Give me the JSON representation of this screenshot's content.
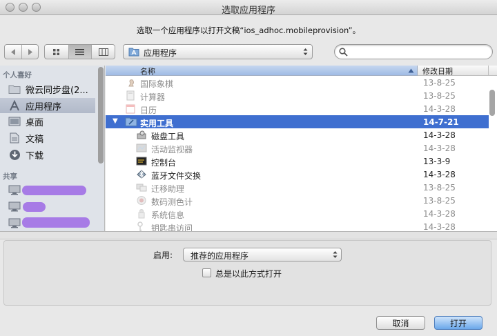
{
  "window": {
    "title": "选取应用程序",
    "prompt": "选取一个应用程序以打开文稿“ios_adhoc.mobileprovision”。"
  },
  "toolbar": {
    "back_icon": "back-arrow-icon",
    "forward_icon": "forward-arrow-icon",
    "view_icons": [
      "icon-view-icon",
      "list-view-icon",
      "column-view-icon"
    ],
    "active_view": "list",
    "location": "应用程序"
  },
  "sidebar": {
    "favorites_header": "个人喜好",
    "favorites": [
      {
        "label": "微云同步盘(2...",
        "icon": "folder-icon"
      },
      {
        "label": "应用程序",
        "icon": "applications-icon",
        "selected": true
      },
      {
        "label": "桌面",
        "icon": "desktop-icon"
      },
      {
        "label": "文稿",
        "icon": "documents-icon"
      },
      {
        "label": "下载",
        "icon": "downloads-icon"
      }
    ],
    "shared_header": "共享",
    "shared_icon": "computer-icon"
  },
  "list": {
    "columns": {
      "name": "名称",
      "date": "修改日期"
    },
    "rows": [
      {
        "name": "国际象棋",
        "date": "13-8-25",
        "enabled": false,
        "indent": 0,
        "icon": "chess-icon"
      },
      {
        "name": "计算器",
        "date": "13-8-25",
        "enabled": false,
        "indent": 0,
        "icon": "calculator-icon"
      },
      {
        "name": "日历",
        "date": "14-3-28",
        "enabled": false,
        "indent": 0,
        "icon": "calendar-icon"
      },
      {
        "name": "实用工具",
        "date": "14-7-21",
        "enabled": true,
        "indent": 0,
        "icon": "utilities-folder-icon",
        "selected": true,
        "disclosure": "expanded"
      },
      {
        "name": "磁盘工具",
        "date": "14-3-28",
        "enabled": true,
        "indent": 1,
        "icon": "disk-utility-icon"
      },
      {
        "name": "活动监视器",
        "date": "14-3-28",
        "enabled": false,
        "indent": 1,
        "icon": "activity-monitor-icon"
      },
      {
        "name": "控制台",
        "date": "13-3-9",
        "enabled": true,
        "indent": 1,
        "icon": "console-icon"
      },
      {
        "name": "蓝牙文件交换",
        "date": "14-3-28",
        "enabled": true,
        "indent": 1,
        "icon": "bluetooth-icon"
      },
      {
        "name": "迁移助理",
        "date": "13-8-25",
        "enabled": false,
        "indent": 1,
        "icon": "migration-assistant-icon"
      },
      {
        "name": "数码测色计",
        "date": "13-8-25",
        "enabled": false,
        "indent": 1,
        "icon": "color-meter-icon"
      },
      {
        "name": "系统信息",
        "date": "14-3-28",
        "enabled": false,
        "indent": 1,
        "icon": "system-info-icon"
      },
      {
        "name": "钥匙串访问",
        "date": "14-3-28",
        "enabled": false,
        "indent": 1,
        "icon": "keychain-icon"
      }
    ]
  },
  "options": {
    "enable_label": "启用:",
    "enable_value": "推荐的应用程序",
    "always_open_label": "总是以此方式打开",
    "always_open_checked": false
  },
  "buttons": {
    "cancel": "取消",
    "open": "打开"
  },
  "colors": {
    "selection": "#3f6fd0",
    "sidebar": "#dfe3e9",
    "redaction": "#a77be6",
    "default_button": "#6aa7ea"
  }
}
